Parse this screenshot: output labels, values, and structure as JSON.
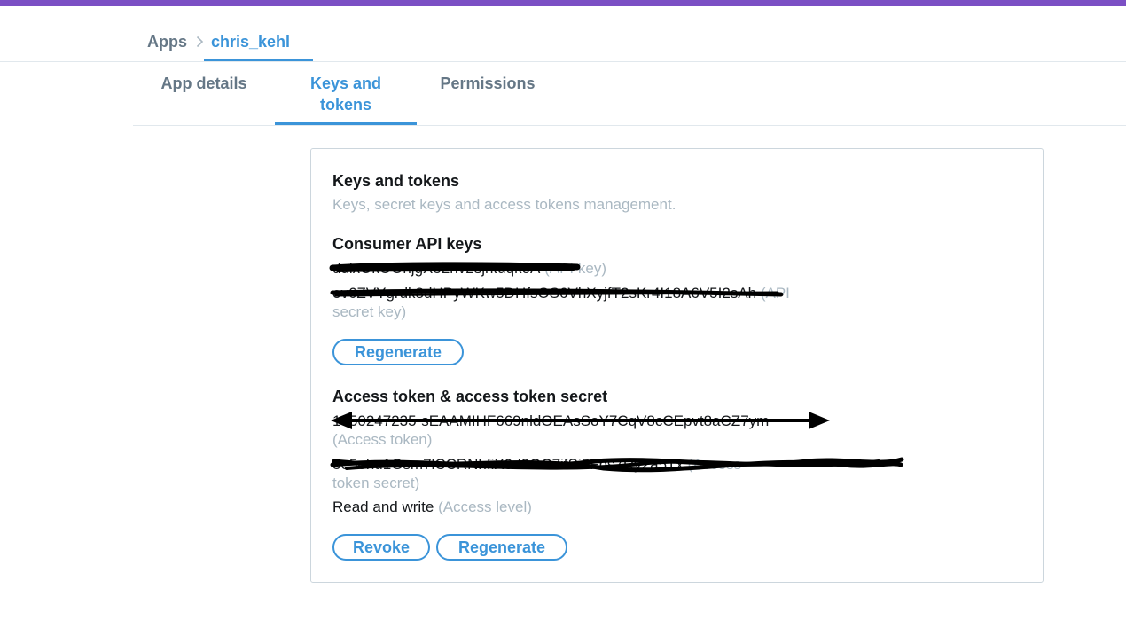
{
  "breadcrumb": {
    "root": "Apps",
    "separator": ">",
    "current": "chris_kehl"
  },
  "tabs": [
    {
      "label": "App details",
      "active": false
    },
    {
      "label": "Keys and tokens",
      "label_line1": "Keys and",
      "label_line2": "tokens",
      "active": true
    },
    {
      "label": "Permissions",
      "active": false
    }
  ],
  "card": {
    "title": "Keys and tokens",
    "subtitle": "Keys, secret keys and access tokens management.",
    "consumer": {
      "heading": "Consumer API keys",
      "api_key": "dulxOkOOnjgX52nv2sjntuqkoA",
      "api_key_label": "(API key)",
      "api_secret": "ev6ZVYgrdk8dHPyWKw5DHfsOS6VhXyjfT2sKr4I18A6V5I2sAh",
      "api_secret_label_1": "(API",
      "api_secret_label_2": "secret key)",
      "regenerate_label": "Regenerate"
    },
    "access": {
      "heading": "Access token & access token secret",
      "token": "1450247235-sEAAMIHF669nldOEAsSoY7CqV8cCEpvt8aCZ7ym",
      "token_label": "(Access token)",
      "secret": "5e5ohu1Gsm7lCCRNhfiX9d8OC7ifSi5Fbs7Ry2a5Tx",
      "secret_label_1": "(Access",
      "secret_label_2": "token secret)",
      "level": "Read and write",
      "level_label": "(Access level)",
      "revoke_label": "Revoke",
      "regenerate_label": "Regenerate"
    }
  },
  "colors": {
    "accent": "#3b94d9",
    "top_bar": "#7b4fc4",
    "muted_text": "#aab8c2",
    "tab_inactive": "#657786",
    "redaction_ink": "#000000"
  },
  "icons": {
    "breadcrumb_separator": "chevron-right-icon"
  }
}
